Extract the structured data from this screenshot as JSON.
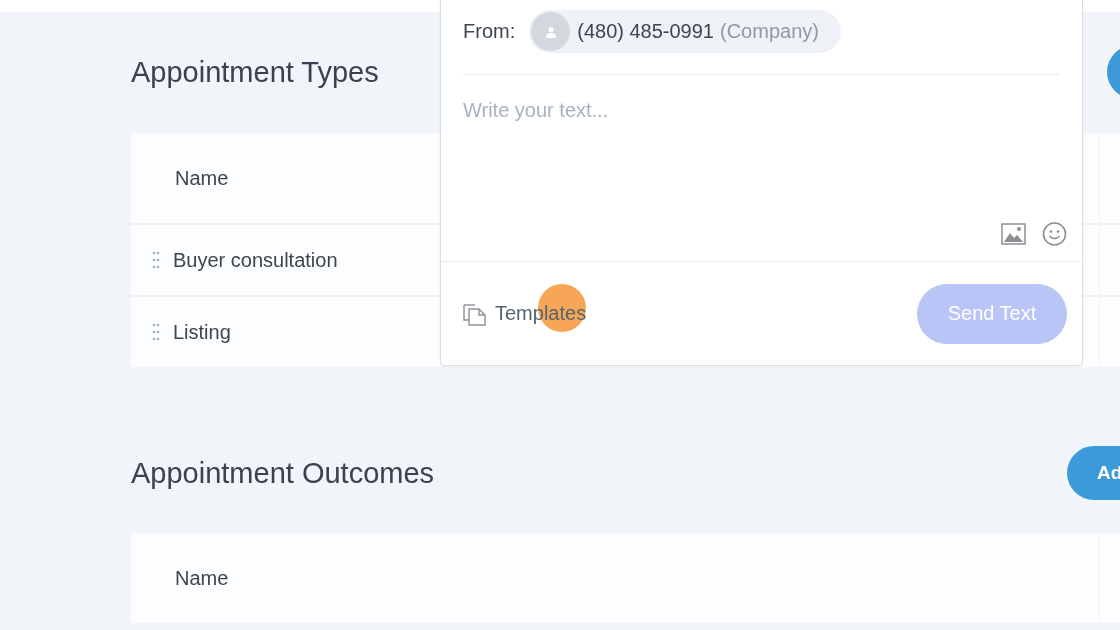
{
  "sections": [
    {
      "title": "Appointment Types",
      "table": {
        "columns": [
          "Name"
        ],
        "rows": [
          {
            "name": "Buyer consultation"
          },
          {
            "name": "Listing"
          }
        ]
      }
    },
    {
      "title": "Appointment Outcomes",
      "button": "Ad",
      "table": {
        "columns": [
          "Name"
        ]
      }
    }
  ],
  "composer": {
    "from_label": "From:",
    "sender": {
      "number": "(480) 485-0991",
      "type": "(Company)"
    },
    "message": {
      "placeholder": "Write your text..."
    },
    "templates_link": "Templates",
    "send_button": {
      "label": "Send Text",
      "disabled": true
    }
  }
}
